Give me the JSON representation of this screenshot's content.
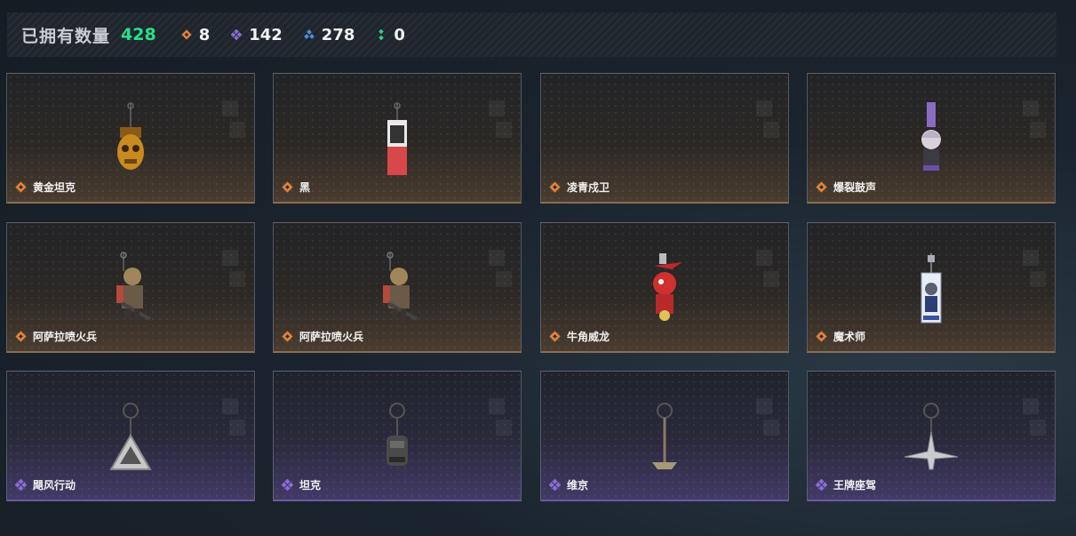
{
  "header": {
    "owned_label": "已拥有数量",
    "owned_count": "428",
    "stats": [
      {
        "icon": "rarity-orange-icon",
        "value": "8",
        "color": "#e0823a"
      },
      {
        "icon": "rarity-purple-icon",
        "value": "142",
        "color": "#8b6cd8"
      },
      {
        "icon": "rarity-blue-icon",
        "value": "278",
        "color": "#4a90e2"
      },
      {
        "icon": "rarity-green-icon",
        "value": "0",
        "color": "#2bd08a"
      }
    ]
  },
  "items": [
    {
      "name": "黄金坦克",
      "rarity": "orange",
      "icon": "golden-skull-charm-icon"
    },
    {
      "name": "黑",
      "rarity": "orange",
      "icon": "card-charm-icon"
    },
    {
      "name": "凌青戍卫",
      "rarity": "orange",
      "icon": "empty-slot-icon"
    },
    {
      "name": "爆裂鼓声",
      "rarity": "orange",
      "icon": "figure-charm-icon"
    },
    {
      "name": "阿萨拉喷火兵",
      "rarity": "orange",
      "icon": "flamethrower-soldier-charm-icon"
    },
    {
      "name": "阿萨拉喷火兵",
      "rarity": "orange",
      "icon": "flamethrower-soldier-charm-icon"
    },
    {
      "name": "牛角威龙",
      "rarity": "orange",
      "icon": "horned-dragon-charm-icon"
    },
    {
      "name": "魔术师",
      "rarity": "orange",
      "icon": "magician-card-charm-icon"
    },
    {
      "name": "飓风行动",
      "rarity": "purple",
      "icon": "triangle-badge-charm-icon"
    },
    {
      "name": "坦克",
      "rarity": "purple",
      "icon": "tank-head-charm-icon"
    },
    {
      "name": "维京",
      "rarity": "purple",
      "icon": "viking-axe-charm-icon"
    },
    {
      "name": "王牌座驾",
      "rarity": "purple",
      "icon": "jet-plane-charm-icon"
    }
  ]
}
